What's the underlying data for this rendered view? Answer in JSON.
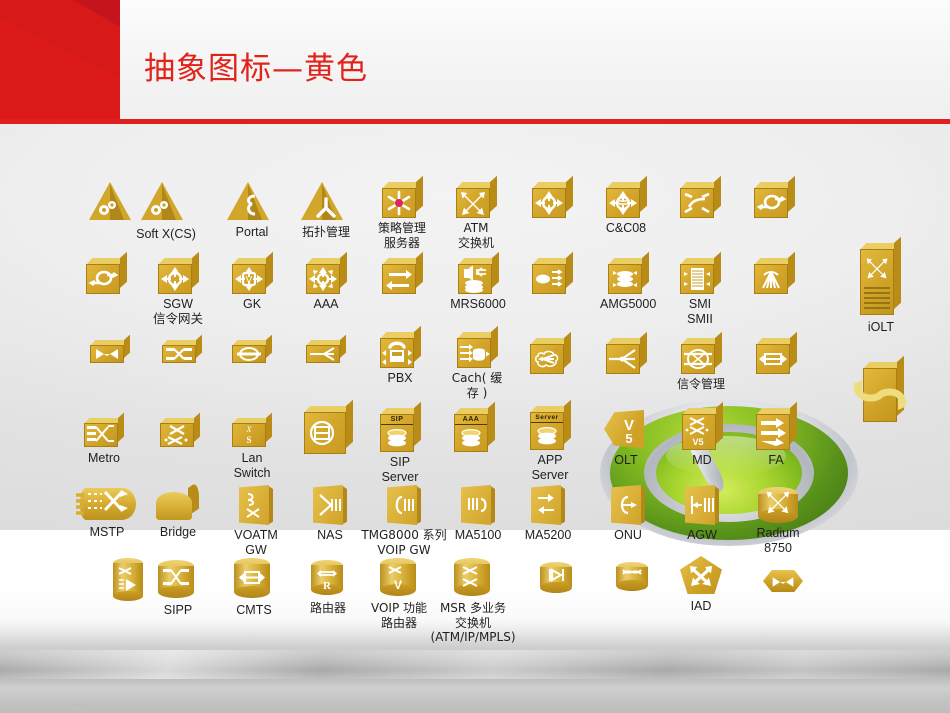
{
  "slide": {
    "title": "抽象图标—黄色",
    "accent_red": "#e2231a",
    "icon_gold": "#d4a72b",
    "background_top": "#efefef",
    "background_band": "#ffffff"
  },
  "icon_rows": [
    {
      "row": 1,
      "icons": [
        {
          "name": "soft-x-cs-a",
          "label": "Soft X(CS)",
          "shape": "triangle",
          "glyph": "gears"
        },
        {
          "name": "soft-x-cs-b",
          "label": "",
          "shape": "triangle",
          "glyph": "gears"
        },
        {
          "name": "portal",
          "label": "Portal",
          "shape": "triangle",
          "glyph": "epsilon"
        },
        {
          "name": "topology-mgmt",
          "label": "拓扑管理",
          "shape": "triangle",
          "glyph": "tri-star"
        },
        {
          "name": "policy-mgmt-server",
          "label": "策略管理\n服务器",
          "shape": "box",
          "glyph": "asterisk-dot"
        },
        {
          "name": "atm-switch",
          "label": "ATM\n交换机",
          "shape": "box",
          "glyph": "x-arrows"
        },
        {
          "name": "switch-circle",
          "label": "",
          "shape": "box",
          "glyph": "circle-4arrows"
        },
        {
          "name": "cc08",
          "label": "C&C08",
          "shape": "box",
          "glyph": "circle-lines-4arrows"
        },
        {
          "name": "switch-curve",
          "label": "",
          "shape": "box",
          "glyph": "curve-4arrows"
        },
        {
          "name": "switch-oval",
          "label": "",
          "shape": "box",
          "glyph": "oval-2arrows"
        }
      ]
    },
    {
      "row": 2,
      "icons": [
        {
          "name": "oval-arrow",
          "label": "",
          "shape": "box",
          "glyph": "oval-2arrows"
        },
        {
          "name": "sgw",
          "label": "SGW\n信令网关",
          "shape": "box",
          "glyph": "circle-4arrows"
        },
        {
          "name": "gk",
          "label": "GK",
          "shape": "box",
          "glyph": "v-4arrows"
        },
        {
          "name": "aaa",
          "label": "AAA",
          "shape": "box",
          "glyph": "sun-8arrows"
        },
        {
          "name": "two-arrows",
          "label": "",
          "shape": "box",
          "glyph": "two-arrows"
        },
        {
          "name": "mrs6000",
          "label": "MRS6000",
          "shape": "box",
          "glyph": "speaker-disks"
        },
        {
          "name": "amg-small",
          "label": "",
          "shape": "box",
          "glyph": "oval-lines"
        },
        {
          "name": "amg5000",
          "label": "AMG5000",
          "shape": "box",
          "glyph": "disks-4arrows"
        },
        {
          "name": "smi-smii",
          "label": "SMI\nSMII",
          "shape": "box",
          "glyph": "stack-2arrows"
        },
        {
          "name": "fan-out",
          "label": "",
          "shape": "box",
          "glyph": "fan"
        },
        {
          "name": "iolt",
          "label": "iOLT",
          "shape": "rack",
          "glyph": "x-arrows"
        }
      ]
    },
    {
      "row": 3,
      "icons": [
        {
          "name": "bowtie-slab",
          "label": "",
          "shape": "slab",
          "glyph": "bowtie"
        },
        {
          "name": "cross-slab",
          "label": "",
          "shape": "slab",
          "glyph": "cross-bars"
        },
        {
          "name": "ring-slab",
          "label": "",
          "shape": "slab",
          "glyph": "ring-bar"
        },
        {
          "name": "splitter-slab",
          "label": "",
          "shape": "slab",
          "glyph": "splitter"
        },
        {
          "name": "pbx",
          "label": "PBX",
          "shape": "box",
          "glyph": "phone-4arrows"
        },
        {
          "name": "cach",
          "label": "Cach( 缓存 )",
          "shape": "box",
          "glyph": "arrows-cylinder"
        },
        {
          "name": "cloud-box",
          "label": "",
          "shape": "box",
          "glyph": "cloud-fan"
        },
        {
          "name": "fan-box",
          "label": "",
          "shape": "box",
          "glyph": "fan-arrow"
        },
        {
          "name": "signal-mgmt",
          "label": "信令管理",
          "shape": "box",
          "glyph": "ellipse-cross"
        },
        {
          "name": "bar-2arrows",
          "label": "",
          "shape": "box",
          "glyph": "bar-2arrows"
        },
        {
          "name": "twist-rack",
          "label": "",
          "shape": "rack",
          "glyph": "twist"
        }
      ]
    },
    {
      "row": 4,
      "icons": [
        {
          "name": "metro",
          "label": "Metro",
          "shape": "slab",
          "glyph": "metro"
        },
        {
          "name": "switch-xx",
          "label": "",
          "shape": "slab",
          "glyph": "x-dots"
        },
        {
          "name": "lan-switch",
          "label": "Lan Switch",
          "shape": "slab",
          "glyph": "x-s"
        },
        {
          "name": "cube-ring",
          "label": "",
          "shape": "cube",
          "glyph": "ring-stack"
        },
        {
          "name": "sip-server",
          "label": "SIP Server",
          "shape": "box",
          "glyph": "disks",
          "badge": "SIP"
        },
        {
          "name": "app-server-aaa",
          "label": "",
          "shape": "box",
          "glyph": "disks",
          "badge": "AAA"
        },
        {
          "name": "app-server",
          "label": "APP Server",
          "shape": "box",
          "glyph": "disks",
          "badge": "Server"
        },
        {
          "name": "olt",
          "label": "OLT",
          "shape": "wedge-left",
          "glyph": "v5"
        },
        {
          "name": "md",
          "label": "MD",
          "shape": "box",
          "glyph": "xx-v5"
        },
        {
          "name": "fa",
          "label": "FA",
          "shape": "box",
          "glyph": "arrows-right"
        }
      ]
    },
    {
      "row": 5,
      "icons": [
        {
          "name": "mstp",
          "label": "MSTP",
          "shape": "cyl-side",
          "glyph": "mstp"
        },
        {
          "name": "bridge",
          "label": "Bridge",
          "shape": "arch",
          "glyph": "none"
        },
        {
          "name": "voatm-gw",
          "label": "VOATM GW",
          "shape": "wedge",
          "glyph": "x-curve"
        },
        {
          "name": "nas",
          "label": "NAS",
          "shape": "wedge",
          "glyph": "bars"
        },
        {
          "name": "tmg8000",
          "label": "TMG8000 系列\nVOIP GW",
          "shape": "wedge",
          "glyph": "c-bars"
        },
        {
          "name": "ma5100",
          "label": "MA5100",
          "shape": "wedge",
          "glyph": "bars-c"
        },
        {
          "name": "ma5200",
          "label": "MA5200",
          "shape": "wedge",
          "glyph": "arrows-4"
        },
        {
          "name": "onu",
          "label": "ONU",
          "shape": "wedge",
          "glyph": "c-arrows"
        },
        {
          "name": "agw",
          "label": "AGW",
          "shape": "wedge",
          "glyph": "bars-arrow"
        },
        {
          "name": "radium8750",
          "label": "Radium\n8750",
          "shape": "cyl",
          "glyph": "x-arrows"
        }
      ]
    },
    {
      "row": 6,
      "icons": [
        {
          "name": "sipp-tall",
          "label": "",
          "shape": "cyl-tall",
          "glyph": "play-bars"
        },
        {
          "name": "sipp",
          "label": "SIPP",
          "shape": "cyl",
          "glyph": "cross-bars"
        },
        {
          "name": "cmts",
          "label": "CMTS",
          "shape": "cyl",
          "glyph": "bar-2arrows"
        },
        {
          "name": "router",
          "label": "路由器",
          "shape": "cyl",
          "glyph": "R"
        },
        {
          "name": "voip-router",
          "label": "VOIP 功能\n路由器",
          "shape": "cyl",
          "glyph": "V"
        },
        {
          "name": "msr",
          "label": "MSR 多业务\n交换机\n(ATM/IP/MPLS)",
          "shape": "cyl",
          "glyph": "xx"
        },
        {
          "name": "play-cyl",
          "label": "",
          "shape": "cyl",
          "glyph": "play"
        },
        {
          "name": "swirl-cyl",
          "label": "",
          "shape": "cyl",
          "glyph": "swirl"
        },
        {
          "name": "iad",
          "label": "IAD",
          "shape": "pentagon",
          "glyph": "4arrows"
        },
        {
          "name": "hex-x",
          "label": "",
          "shape": "hexagon",
          "glyph": "bowtie"
        }
      ]
    }
  ]
}
